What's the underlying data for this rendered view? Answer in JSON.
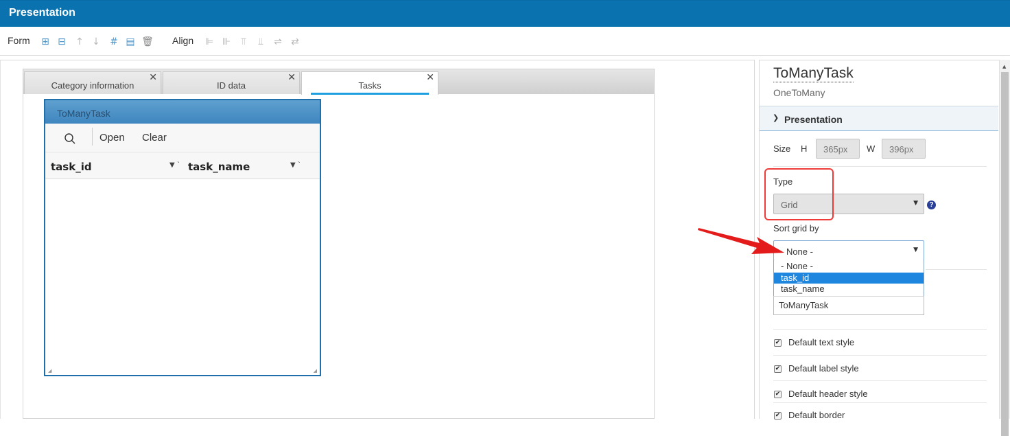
{
  "window": {
    "title": "Presentation"
  },
  "toolbar": {
    "form_label": "Form",
    "align_label": "Align",
    "form_icons": [
      "add-field-above-icon",
      "add-field-below-icon",
      "move-up-icon",
      "move-down-icon",
      "grid-icon",
      "document-icon",
      "trash-icon"
    ],
    "align_icons": [
      "align-left-icon",
      "align-right-icon",
      "align-top-icon",
      "align-bottom-icon",
      "distribute-vertical-icon",
      "distribute-horizontal-icon"
    ]
  },
  "tabs": [
    {
      "label": "Category information",
      "active": false
    },
    {
      "label": "ID data",
      "active": false
    },
    {
      "label": "Tasks",
      "active": true
    }
  ],
  "grid": {
    "title": "ToManyTask",
    "tools": {
      "open": "Open",
      "clear": "Clear"
    },
    "columns": [
      "task_id",
      "task_name"
    ]
  },
  "panel": {
    "title": "ToManyTask",
    "subtitle": "OneToMany",
    "section": "Presentation",
    "size_label": "Size",
    "h_label": "H",
    "h_value": "365px",
    "w_label": "W",
    "w_value": "396px",
    "type_label": "Type",
    "type_value": "Grid",
    "help": "?",
    "sort_label": "Sort grid by",
    "sort_value": "- None -",
    "sort_options": [
      "- None -",
      "task_id",
      "task_name"
    ],
    "sort_selected_index": 1,
    "below_dropdown_text": "ToManyTask",
    "checkboxes": [
      {
        "label": "Default text style",
        "checked": true
      },
      {
        "label": "Default label style",
        "checked": true
      },
      {
        "label": "Default header style",
        "checked": true
      },
      {
        "label": "Default border",
        "checked": true
      }
    ]
  },
  "colors": {
    "titlebar": "#0b72b0",
    "accent": "#1f86e0",
    "highlight_red": "#ef3a3a"
  }
}
